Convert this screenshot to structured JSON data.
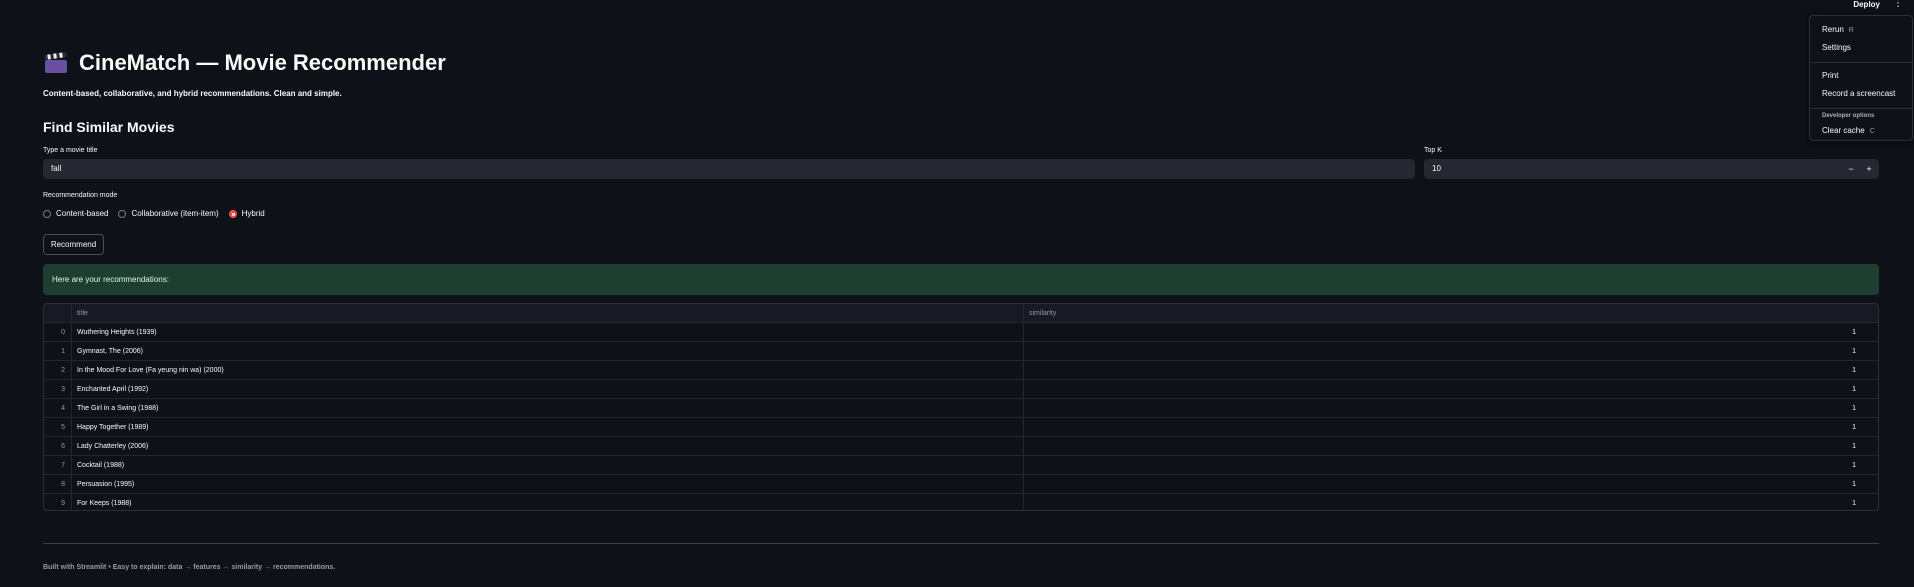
{
  "header": {
    "deploy_label": "Deploy",
    "menu_icon": "kebab-menu-icon"
  },
  "app": {
    "title": "CineMatch — Movie Recommender",
    "title_icon": "clapper-board-icon",
    "subtitle": "Content-based, collaborative, and hybrid recommendations. Clean and simple.",
    "section_title": "Find Similar Movies"
  },
  "form": {
    "movie_label": "Type a movie title",
    "movie_value": "fall",
    "topk_label": "Top K",
    "topk_value": "10",
    "minus": "−",
    "plus": "+",
    "mode_label": "Recommendation mode",
    "modes": [
      {
        "label": "Content-based",
        "selected": false
      },
      {
        "label": "Collaborative (item-item)",
        "selected": false
      },
      {
        "label": "Hybrid",
        "selected": true
      }
    ],
    "recommend_label": "Recommend"
  },
  "result": {
    "success_text": "Here are your recommendations:"
  },
  "table": {
    "columns": [
      "title",
      "similarity"
    ],
    "rows": [
      {
        "idx": "0",
        "title": "Wuthering Heights (1939)",
        "similarity": "1"
      },
      {
        "idx": "1",
        "title": "Gymnast, The (2006)",
        "similarity": "1"
      },
      {
        "idx": "2",
        "title": "In the Mood For Love (Fa yeung nin wa) (2000)",
        "similarity": "1"
      },
      {
        "idx": "3",
        "title": "Enchanted April (1992)",
        "similarity": "1"
      },
      {
        "idx": "4",
        "title": "The Girl in a Swing (1988)",
        "similarity": "1"
      },
      {
        "idx": "5",
        "title": "Happy Together (1989)",
        "similarity": "1"
      },
      {
        "idx": "6",
        "title": "Lady Chatterley (2006)",
        "similarity": "1"
      },
      {
        "idx": "7",
        "title": "Cocktail (1988)",
        "similarity": "1"
      },
      {
        "idx": "8",
        "title": "Persuasion (1995)",
        "similarity": "1"
      },
      {
        "idx": "9",
        "title": "For Keeps (1988)",
        "similarity": "1"
      }
    ]
  },
  "footer": {
    "text": "Built with Streamlit • Easy to explain: data → features → similarity → recommendations."
  },
  "menu": {
    "rerun": "Rerun",
    "rerun_key": "R",
    "settings": "Settings",
    "print": "Print",
    "record": "Record a screencast",
    "dev_section": "Developer options",
    "clear_cache": "Clear cache",
    "clear_key": "C"
  },
  "colors": {
    "background": "#0e1117",
    "input_bg": "#262730",
    "accent": "#ff4b4b",
    "success_bg": "#1e3f2f"
  }
}
